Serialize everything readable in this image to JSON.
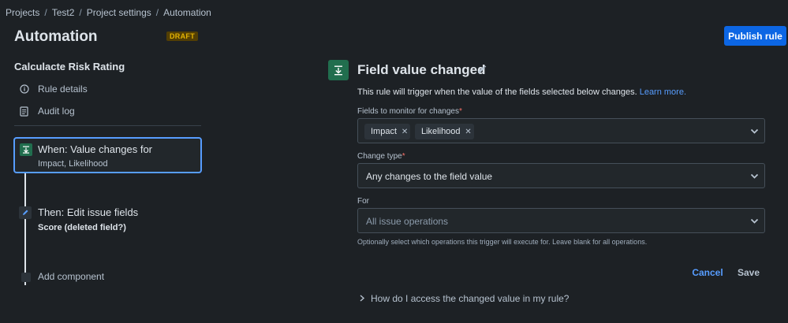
{
  "breadcrumb": {
    "items": [
      "Projects",
      "Test2",
      "Project settings",
      "Automation"
    ],
    "separator": "/"
  },
  "header": {
    "title": "Automation",
    "badge": "DRAFT",
    "publish_label": "Publish rule"
  },
  "sidebar": {
    "rule_name": "Calculacte Risk Rating",
    "links": [
      {
        "label": "Rule details",
        "icon": "info-icon"
      },
      {
        "label": "Audit log",
        "icon": "document-icon"
      }
    ],
    "trigger": {
      "title": "When: Value changes for",
      "subtitle": "Impact, Likelihood",
      "icon": "trigger-icon"
    },
    "action": {
      "title": "Then: Edit issue fields",
      "subtitle": "Score (deleted field?)",
      "icon": "pencil-icon"
    },
    "add_component": "Add component"
  },
  "panel": {
    "title": "Field value changed",
    "description": "This rule will trigger when the value of the fields selected below changes.",
    "learn_more": "Learn more.",
    "fields_label": "Fields to monitor for changes",
    "fields_chips": [
      "Impact",
      "Likelihood"
    ],
    "change_type_label": "Change type",
    "change_type_value": "Any changes to the field value",
    "for_label": "For",
    "for_placeholder": "All issue operations",
    "helper": "Optionally select which operations this trigger will execute for. Leave blank for all operations.",
    "required_mark": "*",
    "cancel_label": "Cancel",
    "save_label": "Save",
    "faq": "How do I access the changed value in my rule?"
  },
  "colors": {
    "background": "#1d2125",
    "accent": "#579dff",
    "primary_button": "#0c66e4",
    "trigger_green": "#216e4e",
    "draft_badge_bg": "#533f04",
    "draft_badge_text": "#e2b203",
    "required": "#f87168"
  }
}
